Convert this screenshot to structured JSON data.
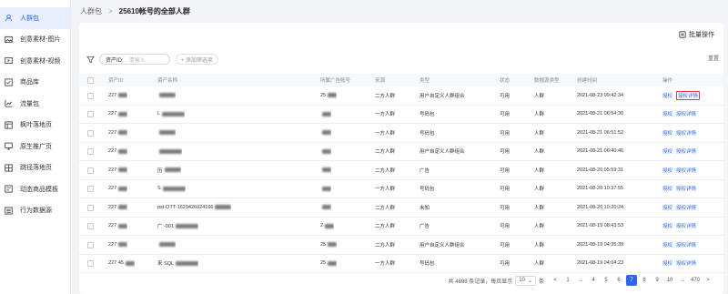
{
  "sidebar": {
    "items": [
      {
        "label": "人群包",
        "icon": "people-icon",
        "active": true
      },
      {
        "label": "创意素材-图片",
        "icon": "image-icon"
      },
      {
        "label": "创意素材-视频",
        "icon": "video-icon"
      },
      {
        "label": "商品库",
        "icon": "checklist-icon"
      },
      {
        "label": "流量包",
        "icon": "chart-icon"
      },
      {
        "label": "枫叶落地页",
        "icon": "page-icon"
      },
      {
        "label": "原生推广页",
        "icon": "monitor-icon"
      },
      {
        "label": "跳径落地页",
        "icon": "layout-icon"
      },
      {
        "label": "动态商品模板",
        "icon": "template-icon"
      },
      {
        "label": "行为数据源",
        "icon": "list-icon"
      }
    ]
  },
  "breadcrumb": {
    "parent": "人群包",
    "separator": ">",
    "current": "25610帐号的全部人群"
  },
  "toolbar": {
    "bulk_label": "批量操作",
    "bulk_icon": "batch-icon"
  },
  "filter": {
    "icon": "filter-icon",
    "tag_label": "资产ID:",
    "tag_placeholder": "请输入",
    "add_label": "+ 添加筛选项",
    "reset_label": "重置"
  },
  "table": {
    "columns": [
      "资产ID",
      "资产名称",
      "所属广告账号",
      "来源",
      "类型",
      "状态",
      "数据源类型",
      "创建时间",
      "操作"
    ],
    "rows": [
      {
        "id": "227",
        "name": "",
        "account": "25",
        "source": "二方人群",
        "type": "用户自定义人群组合",
        "status": "可用",
        "ds": "人群",
        "created": "2021-08-23 09:42:34"
      },
      {
        "id": "227",
        "name": "L",
        "account": "",
        "source": "一方人群",
        "type": "号码包",
        "status": "可用",
        "ds": "人群",
        "created": "2021-08-21 06:54:30"
      },
      {
        "id": "227",
        "name": "",
        "account": "",
        "source": "一方人群",
        "type": "号码包",
        "status": "可用",
        "ds": "人群",
        "created": "2021-08-21 06:51:52"
      },
      {
        "id": "227",
        "name": "",
        "account": "",
        "source": "二方人群",
        "type": "用户自定义人群组合",
        "status": "可用",
        "ds": "人群",
        "created": "2021-08-21 06:40:46"
      },
      {
        "id": "227",
        "name": "历",
        "account": "",
        "source": "二方人群",
        "type": "广告",
        "status": "可用",
        "ds": "人群",
        "created": "2021-08-20 05:59:31"
      },
      {
        "id": "227",
        "name": "S",
        "account": "",
        "source": "一方人群",
        "type": "号码包",
        "status": "可用",
        "ds": "人群",
        "created": "2021-08-20 10:37:55"
      },
      {
        "id": "227",
        "name": "pst-OTT-1629426024166",
        "account": "",
        "source": "二方人群",
        "type": "未知",
        "status": "可用",
        "ds": "人群",
        "created": "2021-08-20 10:20:24"
      },
      {
        "id": "227",
        "name": "广 -001",
        "account": "2",
        "source": "二方人群",
        "type": "广告",
        "status": "可用",
        "ds": "人群",
        "created": "2021-08-19 08:43:53"
      },
      {
        "id": "227",
        "name": "",
        "account": "25",
        "source": "二方人群",
        "type": "用户自定义人群组合",
        "status": "可用",
        "ds": "人群",
        "created": "2021-08-19 04:35:39"
      },
      {
        "id": "227 45",
        "name": "来 SQL",
        "account": "25",
        "source": "一方人群",
        "type": "号码包",
        "status": "可用",
        "ds": "人群",
        "created": "2021-08-19 04:04:23"
      }
    ],
    "actions": {
      "auth": "授权",
      "detail": "授权详情"
    }
  },
  "pagination": {
    "total_text": "共 4698 条记录，每页显示",
    "page_size": "10",
    "unit": "条",
    "pages": [
      "1",
      "...",
      "4",
      "5",
      "6",
      "7",
      "8",
      "9",
      "10",
      "...",
      "470"
    ],
    "current": "7",
    "prev": "<",
    "next": ">"
  }
}
